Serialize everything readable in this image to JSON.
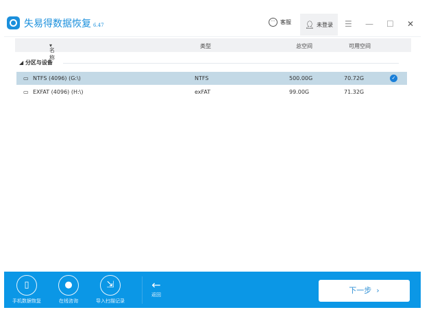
{
  "app": {
    "title": "失易得数据恢复",
    "version": "6.47"
  },
  "titlebar": {
    "service": "客服",
    "login": "未登录"
  },
  "table": {
    "headers": [
      "名称",
      "类型",
      "总空间",
      "可用空间"
    ],
    "section": "分区与设备",
    "rows": [
      {
        "name": "NTFS  (4096)   (G:\\)",
        "type": "NTFS",
        "total": "500.00G",
        "free": "70.72G",
        "selected": true
      },
      {
        "name": "EXFAT  (4096)   (H:\\)",
        "type": "exFAT",
        "total": "99.00G",
        "free": "71.32G",
        "selected": false
      }
    ]
  },
  "footer": {
    "items": [
      "手机数据恢复",
      "在线咨询",
      "导入扫描记录"
    ],
    "back": "返回",
    "next": "下一步"
  },
  "colors": {
    "accent": "#0b97e6",
    "selected": "#c3d9e6"
  }
}
